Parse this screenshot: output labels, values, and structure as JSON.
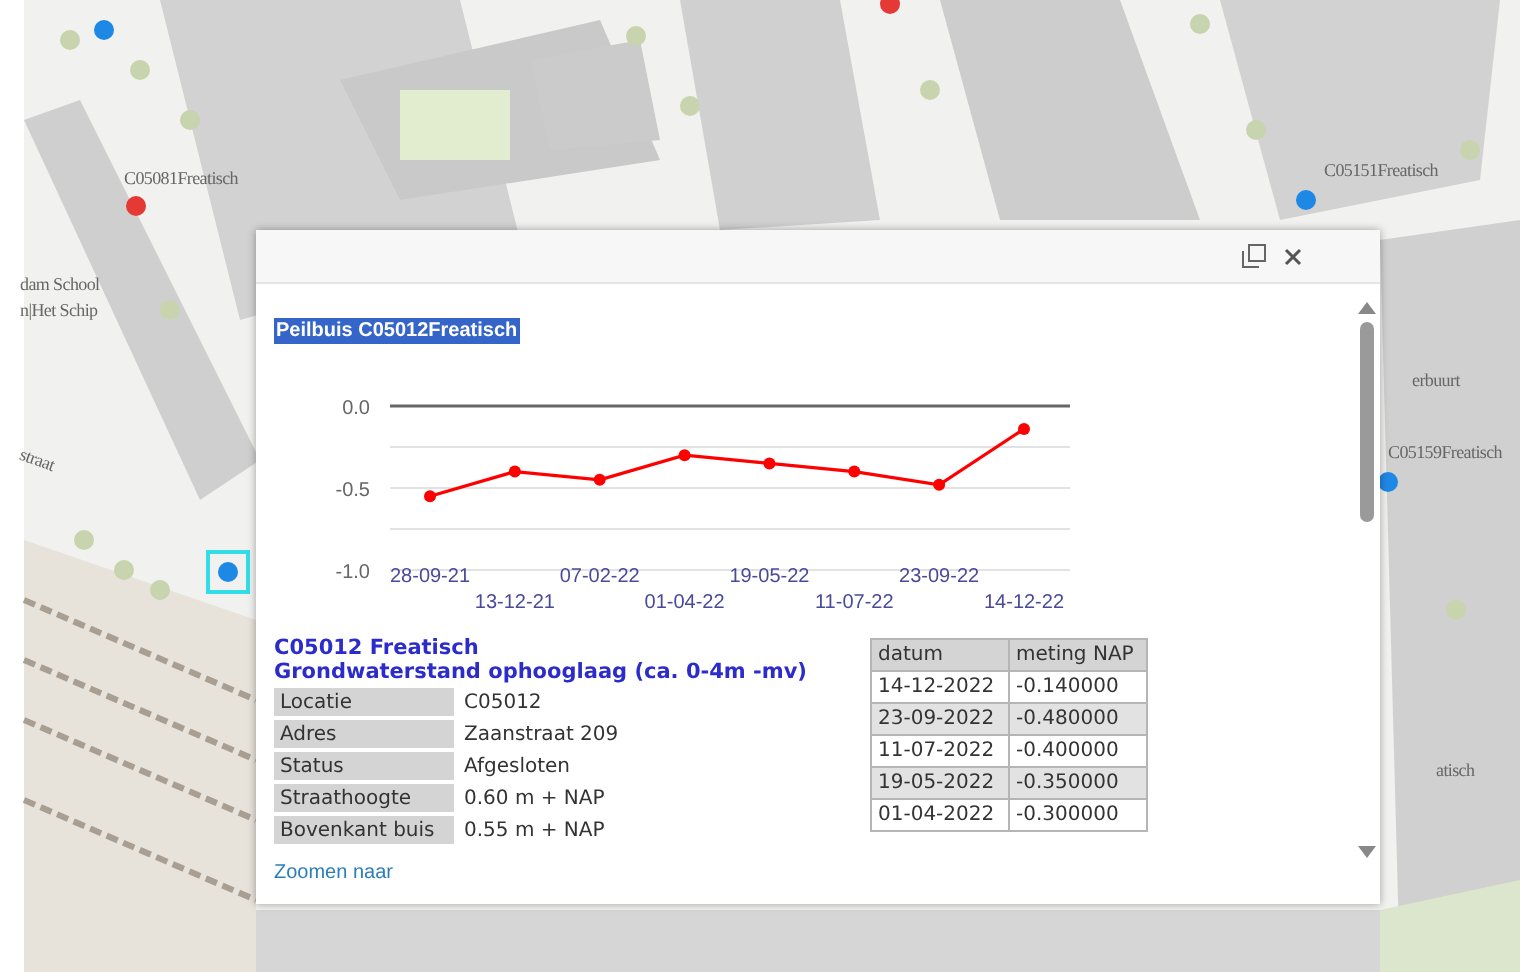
{
  "map": {
    "labels": [
      {
        "text": "C05081Freatisch"
      },
      {
        "text": "C05151Freatisch"
      },
      {
        "text": "C05159Freatisch"
      },
      {
        "text": "dam School"
      },
      {
        "text": "n|Het Schip"
      },
      {
        "text": "straat"
      },
      {
        "text": "erbuurt"
      },
      {
        "text": "atisch"
      }
    ],
    "markers": [
      {
        "color": "#1e88e5",
        "selected": false
      },
      {
        "color": "#e53935",
        "selected": false
      },
      {
        "color": "#e53935",
        "selected": false
      },
      {
        "color": "#1e88e5",
        "selected": false
      },
      {
        "color": "#1e88e5",
        "selected": false
      },
      {
        "color": "#1e88e5",
        "selected": true
      }
    ]
  },
  "popup": {
    "title": "Peilbuis C05012Freatisch",
    "chart_data": {
      "type": "line",
      "categories": [
        "28-09-21",
        "13-12-21",
        "07-02-22",
        "01-04-22",
        "19-05-22",
        "11-07-22",
        "23-09-22",
        "14-12-22"
      ],
      "series": [
        {
          "color": "#ff0000",
          "marker": true,
          "values": [
            -0.55,
            -0.4,
            -0.45,
            -0.3,
            -0.35,
            -0.4,
            -0.48,
            -0.14
          ]
        }
      ],
      "ylim": [
        -1,
        0
      ],
      "yticks": [
        {
          "value": 0,
          "label": "0.0"
        },
        {
          "value": -0.5,
          "label": "-0.5"
        },
        {
          "value": -1,
          "label": "-1.0"
        }
      ]
    },
    "heading": "C05012 Freatisch",
    "subheading": "Grondwaterstand ophooglaag (ca. 0-4m -mv)",
    "attributes": [
      {
        "label": "Locatie",
        "value": "C05012"
      },
      {
        "label": "Adres",
        "value": "Zaanstraat 209"
      },
      {
        "label": "Status",
        "value": "Afgesloten"
      },
      {
        "label": "Straathoogte",
        "value": "0.60 m + NAP"
      },
      {
        "label": "Bovenkant buis",
        "value": "0.55 m + NAP"
      }
    ],
    "measurements": {
      "columns": [
        "datum",
        "meting NAP"
      ],
      "rows": [
        [
          "14-12-2022",
          "-0.140000"
        ],
        [
          "23-09-2022",
          "-0.480000"
        ],
        [
          "11-07-2022",
          "-0.400000"
        ],
        [
          "19-05-2022",
          "-0.350000"
        ],
        [
          "01-04-2022",
          "-0.300000"
        ]
      ]
    },
    "link": "Zoomen naar"
  }
}
